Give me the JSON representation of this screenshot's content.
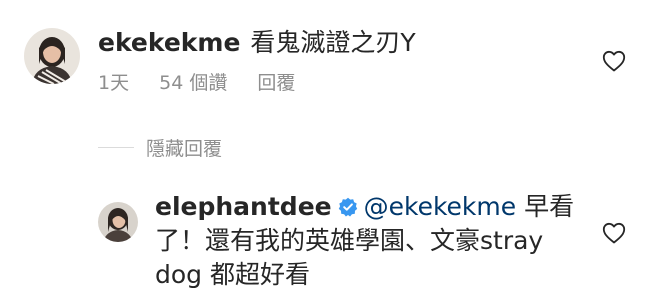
{
  "comment": {
    "username": "ekekekme",
    "text": "看鬼滅證之刃Y",
    "meta": {
      "time": "1天",
      "likes": "54 個讚",
      "reply": "回覆"
    },
    "like_icon": "heart-outline-icon"
  },
  "hide_replies": {
    "label": "隱藏回覆"
  },
  "reply": {
    "username": "elephantdee",
    "verified_icon": "verified-badge-icon",
    "mention": "@ekekekme",
    "text": " 早看了！還有我的英雄學園、文豪stray dog 都超好看",
    "like_icon": "heart-outline-icon"
  },
  "colors": {
    "text": "#262626",
    "secondary": "#8e8e8e",
    "mention": "#00376b",
    "verified": "#3897f0"
  }
}
